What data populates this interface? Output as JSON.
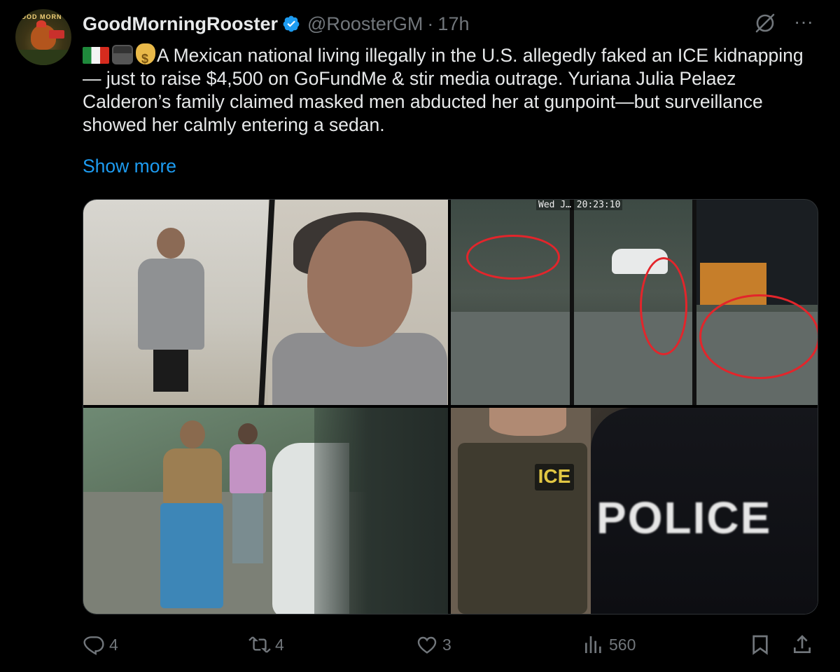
{
  "post": {
    "author": {
      "name": "GoodMorningRooster",
      "handle": "@RoosterGM",
      "separator": "·",
      "time": "17h",
      "avatar_text": "OOD MORN"
    },
    "text_emojis": [
      "mexico-flag",
      "detective",
      "money-bag"
    ],
    "text": "A Mexican national living illegally in the U.S. allegedly faked an ICE kidnapping — just to raise $4,500 on GoFundMe & stir media outrage. Yuriana Julia Pelaez Calderon’s family claimed masked men abducted her at gunpoint—but surveillance showed her calmly entering a sedan.",
    "show_more": "Show more",
    "media": {
      "timestamp_overlay": "Wed J… 20:23:10",
      "ice_patch": "ICE",
      "police_patch": "POLICE"
    },
    "actions": {
      "replies": "4",
      "reposts": "4",
      "likes": "3",
      "views": "560"
    },
    "colors": {
      "link": "#1d9bf0",
      "muted": "#71767b",
      "verified": "#1d9bf0",
      "highlight_rings": "#e3252b"
    }
  }
}
